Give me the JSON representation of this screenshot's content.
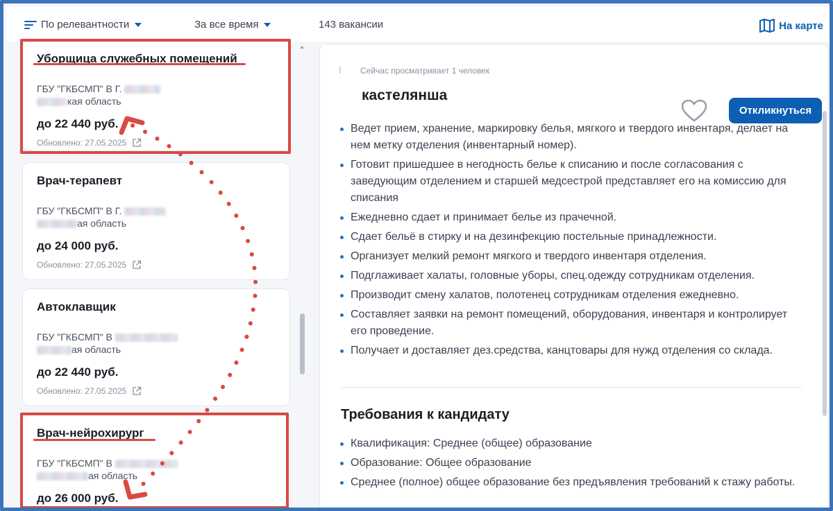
{
  "toolbar": {
    "sort_label": "По релевантности",
    "time_label": "За все время",
    "count_label": "143 вакансии",
    "map_label": "На карте"
  },
  "cards": [
    {
      "title": "Уборщица служебных помещений",
      "company": "ГБУ \"ГКБСМП\" В Г.",
      "region": "кая область",
      "salary": "до 22 440 руб.",
      "updated": "Обновлено: 27.05.2025"
    },
    {
      "title": "Врач-терапевт",
      "company": "ГБУ \"ГКБСМП\" В Г.",
      "region": "ая область",
      "salary": "до 24 000 руб.",
      "updated": "Обновлено: 27.05.2025"
    },
    {
      "title": "Автоклавщик",
      "company": "ГБУ \"ГКБСМП\" В",
      "region": "ая область",
      "salary": "до 22 440 руб.",
      "updated": "Обновлено: 27.05.2025"
    },
    {
      "title": "Врач-нейрохирург",
      "company": "ГБУ \"ГКБСМП\" В",
      "region": "ая область",
      "salary": "до 26 000 руб.",
      "updated": ""
    }
  ],
  "detail": {
    "viewing": "Сейчас просматривает 1 человек",
    "title": "кастелянша",
    "apply_label": "Откликнуться",
    "duties": [
      "Ведет прием, хранение, маркировку белья, мягкого и твердого инвентаря, делает на нем метку отделения (инвентарный номер).",
      "Готовит пришедшее в негодность белье к списанию и после согласования с заведующим отделением и старшей медсестрой представляет его на комиссию для списания",
      "Ежедневно сдает и принимает белье из прачечной.",
      "Сдает бельё в стирку и на дезинфекцию постельные принадлежности.",
      "Организует мелкий ремонт мягкого и твердого инвентаря отделения.",
      "Подглаживает халаты, головные уборы, спец.одежду сотрудникам отделения.",
      "Производит смену халатов, полотенец сотрудникам отделения ежедневно.",
      "Составляет заявки на ремонт помещений, оборудования, инвентаря и контролирует его проведение.",
      "Получает и доставляет дез.средства, канцтовары для нужд отделения со склада."
    ],
    "requirements_heading": "Требования к кандидату",
    "requirements": [
      "Квалификация: Среднее (общее) образование",
      "Образование: Общее образование",
      "Среднее (полное) общее образование без предъявления требований к стажу работы."
    ]
  },
  "colors": {
    "accent": "#0d5fb4",
    "frame": "#3c74b8",
    "annotation": "#d94a43"
  }
}
